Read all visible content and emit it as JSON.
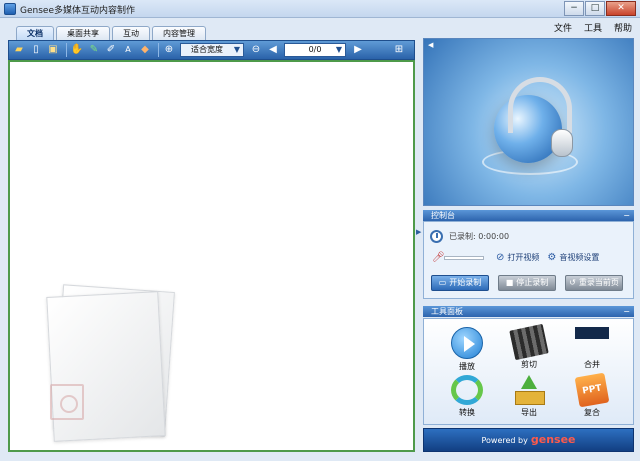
{
  "window": {
    "title": "Gensee多媒体互动内容制作",
    "min": "−",
    "max": "□",
    "close": "✕"
  },
  "menu": {
    "file": "文件",
    "tools": "工具",
    "help": "帮助"
  },
  "tabs": [
    "文档",
    "桌面共享",
    "互动",
    "内容管理"
  ],
  "toolbar": {
    "zoom_label": "适合宽度",
    "page_indicator": "0/0",
    "icons": [
      "open-folder-icon",
      "new-document-icon",
      "save-icon",
      "hand-icon",
      "pen-icon",
      "marker-icon",
      "text-icon",
      "eraser-icon",
      "zoom-in-icon",
      "zoom-out-icon",
      "prev-page-icon",
      "next-page-icon",
      "grid-icon"
    ]
  },
  "control_panel": {
    "header": "控制台",
    "recorded": "已录制: 0:00:00",
    "open_video": "打开视频",
    "av_settings": "音视频设置",
    "start_record": "开始录制",
    "stop_record": "停止录制",
    "rerecord_page": "重录当前页"
  },
  "tool_panel": {
    "header": "工具面板",
    "items": [
      "播放",
      "剪切",
      "合并",
      "转换",
      "导出",
      "复合"
    ]
  },
  "footer": {
    "powered_by": "Powered by",
    "brand": "gensee"
  },
  "colors": {
    "accent": "#2d64ad",
    "canvas_border": "#4e9a4a",
    "brand": "#ff5a4a"
  }
}
